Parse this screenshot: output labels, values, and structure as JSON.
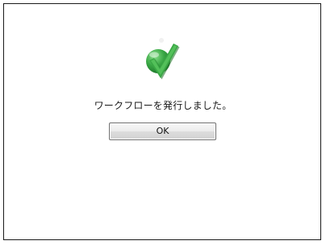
{
  "dialog": {
    "icon": "success-checkmark-icon",
    "message": "ワークフローを発行しました。",
    "ok_label": "OK"
  },
  "colors": {
    "accent_green": "#3aa845",
    "border": "#1a1a1a"
  }
}
